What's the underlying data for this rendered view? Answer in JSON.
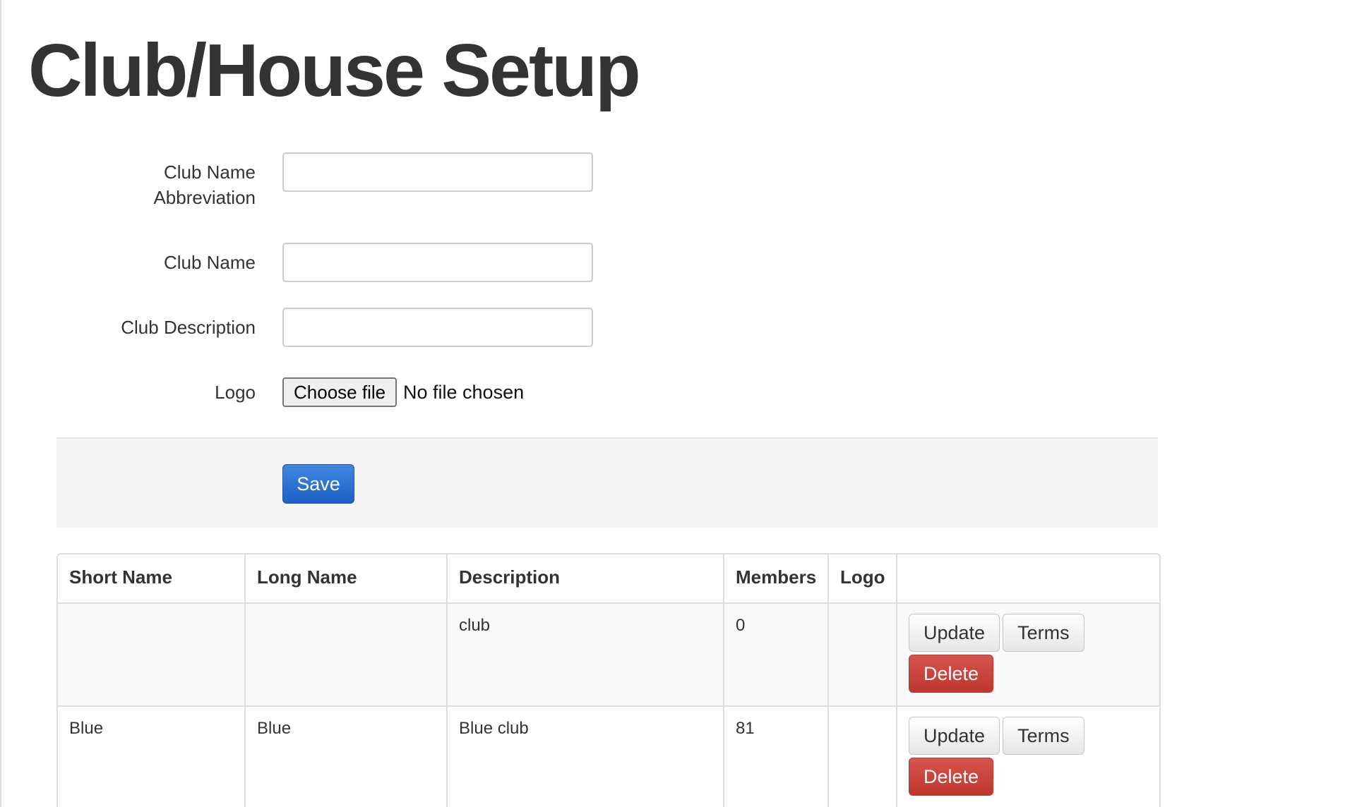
{
  "page": {
    "title": "Club/House Setup"
  },
  "form": {
    "abbreviation_label": "Club Name Abbreviation",
    "abbreviation_value": "",
    "name_label": "Club Name",
    "name_value": "",
    "description_label": "Club Description",
    "description_value": "",
    "logo_label": "Logo",
    "choose_file_label": "Choose file",
    "file_status": "No file chosen",
    "save_label": "Save"
  },
  "table": {
    "headers": [
      "Short Name",
      "Long Name",
      "Description",
      "Members",
      "Logo",
      ""
    ],
    "rows": [
      {
        "short_name": "",
        "long_name": "",
        "description": "club",
        "members": "0",
        "logo": "",
        "update_label": "Update",
        "terms_label": "Terms",
        "delete_label": "Delete"
      },
      {
        "short_name": "Blue",
        "long_name": "Blue",
        "description": "Blue club",
        "members": "81",
        "logo": "",
        "update_label": "Update",
        "terms_label": "Terms",
        "delete_label": "Delete"
      }
    ]
  },
  "colors": {
    "primary_button": "#2468d0",
    "danger_button": "#cc4540",
    "panel_background": "#f5f5f5"
  }
}
